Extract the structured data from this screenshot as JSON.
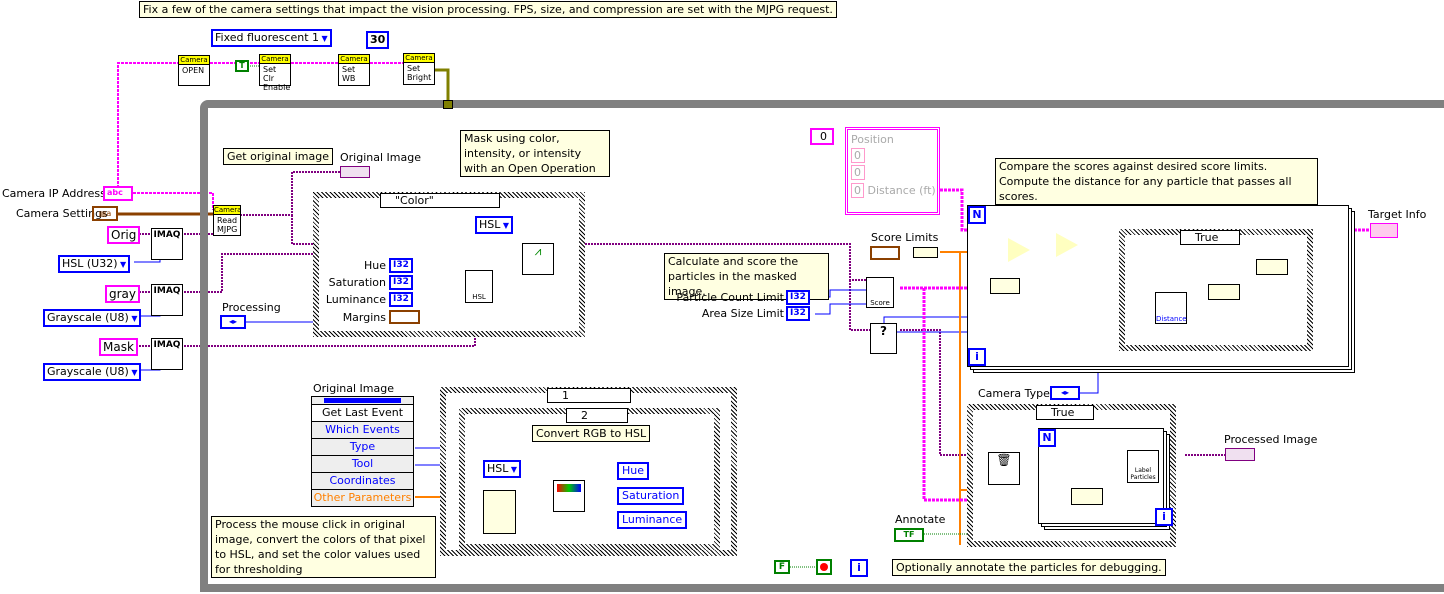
{
  "comments": {
    "top": "Fix a few of the camera settings that impact the vision processing. FPS, size, and compression are set with the MJPG request.",
    "get_image": "Get original image",
    "mask": "Mask using color, intensity, or intensity with an Open Operation",
    "calculate": "Calculate and score the particles in the masked image.",
    "compare": "Compare the scores against desired score limits. Compute the distance for any particle that passes all scores.",
    "convert": "Convert RGB to HSL",
    "process": "Process the mouse click in original image, convert the colors of that pixel to HSL, and set the color values used for thresholding",
    "annotate": "Optionally annotate the particles for debugging."
  },
  "camera": {
    "white_balance": "Fixed fluorescent 1",
    "brightness": "30",
    "bool_true": "T",
    "nodes": [
      {
        "header": "Camera",
        "body": "OPEN"
      },
      {
        "header": "Camera",
        "body": "Set Clr Enable"
      },
      {
        "header": "Camera",
        "body": "Set WB"
      },
      {
        "header": "Camera",
        "body": "Set Bright"
      },
      {
        "header": "Camera",
        "body": "Read MJPG"
      }
    ]
  },
  "controls": {
    "camera_ip": {
      "label": "Camera IP Address",
      "glyph": "abc"
    },
    "camera_settings": {
      "label": "Camera Settings",
      "glyph": "▤a"
    },
    "images": [
      {
        "name": "Orig",
        "type": "HSL (U32)"
      },
      {
        "name": "gray",
        "type": "Grayscale (U8)"
      },
      {
        "name": "Mask",
        "type": "Grayscale (U8)"
      }
    ],
    "imaq": "IMAQ",
    "processing": "Processing",
    "hue": "Hue",
    "saturation": "Saturation",
    "luminance": "Luminance",
    "margins": "Margins",
    "i32": "I32",
    "particle_count_limit": "Particle Count Limit",
    "area_size_limit": "Area Size Limit",
    "score_limits": "Score Limits",
    "camera_type": "Camera Type",
    "annotate": "Annotate",
    "annotate_glyph": "TF"
  },
  "indicators": {
    "original_image": "Original Image",
    "target_info": "Target Info",
    "processed_image": "Processed Image",
    "position_index": "0",
    "position": {
      "label": "Position",
      "x": "0",
      "y": "0",
      "distance": "0",
      "distance_label": "Distance (ft)"
    }
  },
  "case_structures": {
    "color": "\"Color\"",
    "mask_mode": "HSL",
    "score_true": "True",
    "annotate_true": "True",
    "event_case": "1",
    "inner_case": "2",
    "convert_mode": "HSL"
  },
  "nodes": {
    "score": "Score",
    "distance": "Distance",
    "label_particles": "Label Particles",
    "hsl": "HSL"
  },
  "loop_terms": {
    "n": "N",
    "i": "i"
  },
  "events": {
    "source": "Original Image",
    "rows": [
      "Get Last Event",
      "Which Events",
      "Type",
      "Tool",
      "Coordinates",
      "Other Parameters"
    ]
  },
  "hsl_outputs": [
    "Hue",
    "Saturation",
    "Luminance"
  ],
  "stop": {
    "constant": "F"
  },
  "colors": {
    "string_wire": "#ff00ff",
    "image_wire": "#800080",
    "int_wire": "#0000ff",
    "dbl_wire": "#ff8000",
    "cluster_wire": "#8b4000",
    "while_loop": "#808080"
  }
}
